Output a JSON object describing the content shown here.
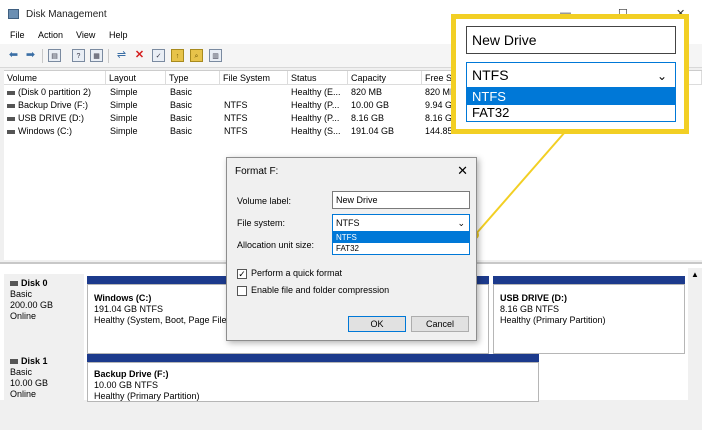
{
  "window": {
    "title": "Disk Management"
  },
  "menu": [
    "File",
    "Action",
    "View",
    "Help"
  ],
  "volume_table": {
    "columns": [
      "Volume",
      "Layout",
      "Type",
      "File System",
      "Status",
      "Capacity",
      "Free Sp"
    ],
    "rows": [
      [
        "(Disk 0 partition 2)",
        "Simple",
        "Basic",
        "",
        "Healthy (E...",
        "820 MB",
        "820 MB"
      ],
      [
        "Backup Drive (F:)",
        "Simple",
        "Basic",
        "NTFS",
        "Healthy (P...",
        "10.00 GB",
        "9.94 GB"
      ],
      [
        "USB DRIVE (D:)",
        "Simple",
        "Basic",
        "NTFS",
        "Healthy (P...",
        "8.16 GB",
        "8.16 GB"
      ],
      [
        "Windows (C:)",
        "Simple",
        "Basic",
        "NTFS",
        "Healthy (S...",
        "191.04 GB",
        "144.85 GB"
      ]
    ]
  },
  "disks": [
    {
      "name": "Disk 0",
      "type": "Basic",
      "size": "200.00 GB",
      "state": "Online",
      "partitions": [
        {
          "name": "Windows (C:)",
          "detail": "191.04 GB NTFS",
          "status": "Healthy (System, Boot, Page File,"
        },
        {
          "name": "USB DRIVE (D:)",
          "detail": "8.16 GB NTFS",
          "status": "Healthy (Primary Partition)"
        }
      ]
    },
    {
      "name": "Disk 1",
      "type": "Basic",
      "size": "10.00 GB",
      "state": "Online",
      "partitions": [
        {
          "name": "Backup Drive (F:)",
          "detail": "10.00 GB NTFS",
          "status": "Healthy (Primary Partition)"
        }
      ]
    }
  ],
  "dialog": {
    "title": "Format F:",
    "volume_label_label": "Volume label:",
    "volume_label_value": "New Drive",
    "file_system_label": "File system:",
    "file_system_value": "NTFS",
    "file_system_options": [
      "NTFS",
      "FAT32"
    ],
    "alloc_label": "Allocation unit size:",
    "quick_format_label": "Perform a quick format",
    "quick_format_checked": true,
    "compression_label": "Enable file and folder compression",
    "compression_checked": false,
    "ok_label": "OK",
    "cancel_label": "Cancel"
  },
  "callout": {
    "volume_label_value": "New Drive",
    "file_system_value": "NTFS",
    "options": [
      "NTFS",
      "FAT32"
    ],
    "border_color": "#f2cf24"
  }
}
